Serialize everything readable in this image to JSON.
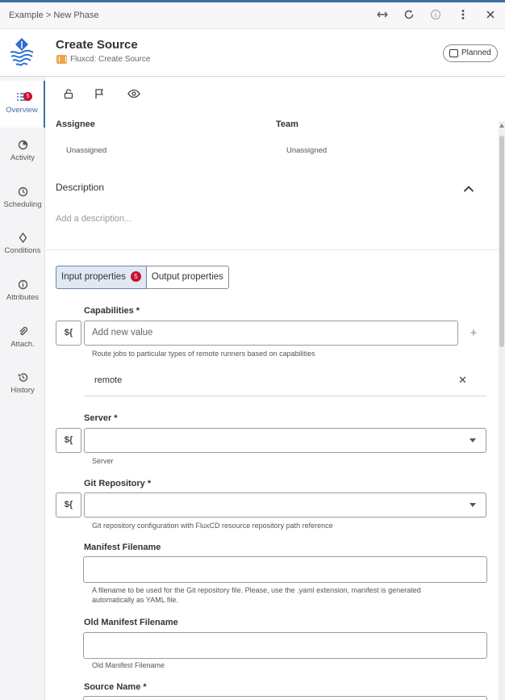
{
  "topbar": {
    "breadcrumb": [
      "Example",
      "New Phase"
    ],
    "breadcrumb_sep": ">",
    "icons": [
      "expand-horizontal-icon",
      "refresh-icon",
      "info-icon",
      "more-vertical-icon",
      "close-icon"
    ]
  },
  "header": {
    "title": "Create Source",
    "subtitle": "Fluxcd: Create Source",
    "status": "Planned"
  },
  "sidebar": {
    "items": [
      {
        "label": "Overview",
        "icon": "list-icon",
        "active": true,
        "badge": "5"
      },
      {
        "label": "Activity",
        "icon": "pie-icon"
      },
      {
        "label": "Scheduling",
        "icon": "clock-icon"
      },
      {
        "label": "Conditions",
        "icon": "diamond-icon"
      },
      {
        "label": "Attributes",
        "icon": "info-icon"
      },
      {
        "label": "Attach.",
        "icon": "paperclip-icon"
      },
      {
        "label": "History",
        "icon": "history-icon"
      }
    ]
  },
  "overview": {
    "assignee_label": "Assignee",
    "assignee_value": "Unassigned",
    "team_label": "Team",
    "team_value": "Unassigned",
    "description_label": "Description",
    "description_placeholder": "Add a description..."
  },
  "tabs": {
    "input": "Input properties",
    "input_badge": "5",
    "output": "Output properties"
  },
  "properties": {
    "var_button": "${",
    "capabilities": {
      "label": "Capabilities *",
      "placeholder": "Add new value",
      "help": "Route jobs to particular types of remote runners based on capabilities",
      "value": "remote"
    },
    "server": {
      "label": "Server *",
      "help": "Server"
    },
    "git_repository": {
      "label": "Git Repository *",
      "help": "Git repository configuration with FluxCD resource repository path reference"
    },
    "manifest_filename": {
      "label": "Manifest Filename",
      "help_line1": "A filename to be used for the Git repository file. Please, use the .yaml extension, manifest is generated",
      "help_line2": "automatically as YAML file."
    },
    "old_manifest_filename": {
      "label": "Old Manifest Filename",
      "help": "Old Manifest Filename"
    },
    "source_name": {
      "label": "Source Name *"
    }
  },
  "colors": {
    "accent": "#3d6ea3",
    "badge": "#c8102e",
    "type_icon": "#f0a54a"
  }
}
